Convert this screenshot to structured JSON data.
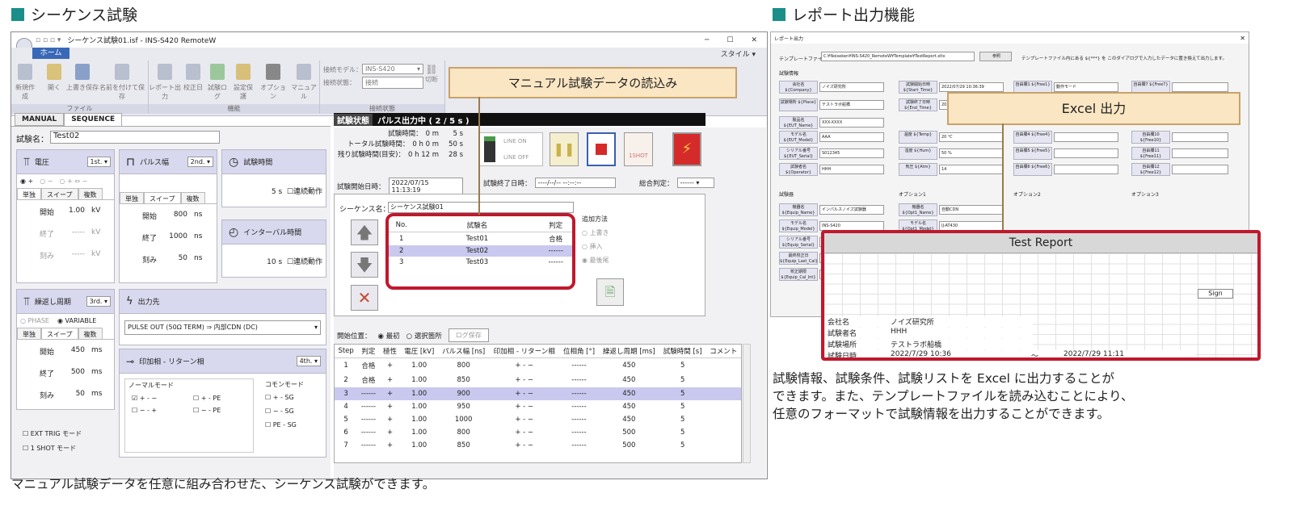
{
  "left_section": {
    "title": "シーケンス試験",
    "caption": "マニュアル試験データを任意に組み合わせた、シーケンス試験ができます。"
  },
  "right_section": {
    "title": "レポート出力機能",
    "caption_lines": [
      "試験情報、試験条件、試験リストを Excel に出力することが",
      "できます。また、テンプレートファイルを読み込むことにより、",
      "任意のフォーマットで試験情報を出力することができます。"
    ]
  },
  "callouts": {
    "manual": "マニュアル試験データの読込み",
    "excel": "Excel 出力"
  },
  "app": {
    "title": "シーケンス試験01.isf - INS-S420 RemoteW",
    "home_tab": "ホーム",
    "style_label": "スタイル",
    "file_group": {
      "label": "ファイル",
      "buttons": [
        "新規作成",
        "開く",
        "上書き保存",
        "名前を付けて保存"
      ]
    },
    "func_group": {
      "label": "機能",
      "buttons": [
        "レポート出力",
        "校正日",
        "試験ログ",
        "設定保護",
        "オプション",
        "マニュアル"
      ]
    },
    "conn_group": {
      "label": "接続状態",
      "model_label": "接続モデル：",
      "model_value": "INS-S420",
      "state_label": "接続状態：",
      "state_value": "接続",
      "disconnect": "切断"
    },
    "mode_tabs": [
      "MANUAL",
      "SEQUENCE"
    ],
    "test_name_label": "試験名：",
    "test_name_value": "Test02",
    "voltage": {
      "title": "電圧",
      "order": "1st.",
      "polarity": [
        "+",
        "−",
        "+ ⇔ −"
      ],
      "tabs": [
        "単独",
        "スイープ",
        "複数"
      ],
      "rows": [
        [
          "開始",
          "1.00",
          "kV"
        ],
        [
          "終了",
          "-----",
          "kV"
        ],
        [
          "刻み",
          "-----",
          "kV"
        ]
      ]
    },
    "pulse_width": {
      "title": "パルス幅",
      "order": "2nd.",
      "tabs": [
        "単独",
        "スイープ",
        "複数"
      ],
      "rows": [
        [
          "開始",
          "800",
          "ns"
        ],
        [
          "終了",
          "1000",
          "ns"
        ],
        [
          "刻み",
          "50",
          "ns"
        ]
      ]
    },
    "test_time": {
      "title": "試験時間",
      "value": "5",
      "unit": "s",
      "check": "連続動作"
    },
    "interval": {
      "title": "インターバル時間",
      "value": "10",
      "unit": "s",
      "check": "連続動作"
    },
    "repeat": {
      "title": "繰返し周期",
      "order": "3rd.",
      "radios": [
        "PHASE",
        "VARIABLE"
      ],
      "tabs": [
        "単独",
        "スイープ",
        "複数"
      ],
      "rows": [
        [
          "開始",
          "450",
          "ms"
        ],
        [
          "終了",
          "500",
          "ms"
        ],
        [
          "刻み",
          "50",
          "ms"
        ]
      ]
    },
    "output": {
      "title": "出力先",
      "value": "PULSE OUT (50Ω TERM) ⇒ 内部CDN (DC)"
    },
    "phase": {
      "title": "印加相 - リターン相",
      "order": "4th.",
      "normal_label": "ノーマルモード",
      "normal_items": [
        "+ - −",
        "+ - PE",
        "− - +",
        "− - PE"
      ],
      "common_label": "コモンモード",
      "common_items": [
        "+ - SG",
        "− - SG",
        "PE - SG"
      ]
    },
    "ext_trig": "EXT TRIG モード",
    "one_shot": "1 SHOT モード",
    "status": {
      "label": "試験状態",
      "value": "パルス出力中 ( 2 / 5 s )"
    },
    "times": [
      [
        "試験時間：",
        "0 m",
        "5 s"
      ],
      [
        "トータル試験時間：",
        "0 h  0 m",
        "50 s"
      ],
      [
        "残り試験時間(目安)：",
        "0 h  12 m",
        "28 s"
      ]
    ],
    "line_on": "LINE ON",
    "line_off": "LINE OFF",
    "oneshot_btn": "1SHOT",
    "start_label": "試験開始日時：",
    "start_value": "2022/07/15 11:13:19",
    "end_label": "試験終了日時：",
    "end_value": "----/--/-- --:--:--",
    "judge_label": "総合判定：",
    "judge_value": "------",
    "seq_name_label": "シーケンス名：",
    "seq_name_value": "シーケンス試験01",
    "seq_table": {
      "headers": [
        "No.",
        "試験名",
        "判定"
      ],
      "rows": [
        [
          "1",
          "Test01",
          "合格"
        ],
        [
          "2",
          "Test02",
          "------"
        ],
        [
          "3",
          "Test03",
          "------"
        ]
      ]
    },
    "add_method": {
      "label": "追加方法",
      "options": [
        "上書き",
        "挿入",
        "最後尾"
      ]
    },
    "start_pos": {
      "label": "開始位置：",
      "options": [
        "最初",
        "選択箇所"
      ],
      "log_btn": "ログ保存"
    },
    "result_table": {
      "headers": [
        "Step",
        "判定",
        "極性",
        "電圧 [kV]",
        "パルス幅 [ns]",
        "印加相 - リターン相",
        "位相角 [°]",
        "繰返し周期 [ms]",
        "試験時間 [s]",
        "コメント"
      ],
      "rows": [
        [
          "1",
          "合格",
          "+",
          "1.00",
          "800",
          "+ - −",
          "------",
          "450",
          "5",
          ""
        ],
        [
          "2",
          "合格",
          "+",
          "1.00",
          "850",
          "+ - −",
          "------",
          "450",
          "5",
          ""
        ],
        [
          "3",
          "------",
          "+",
          "1.00",
          "900",
          "+ - −",
          "------",
          "450",
          "5",
          ""
        ],
        [
          "4",
          "------",
          "+",
          "1.00",
          "950",
          "+ - −",
          "------",
          "450",
          "5",
          ""
        ],
        [
          "5",
          "------",
          "+",
          "1.00",
          "1000",
          "+ - −",
          "------",
          "450",
          "5",
          ""
        ],
        [
          "6",
          "------",
          "+",
          "1.00",
          "800",
          "+ - −",
          "------",
          "500",
          "5",
          ""
        ],
        [
          "7",
          "------",
          "+",
          "1.00",
          "850",
          "+ - −",
          "------",
          "500",
          "5",
          ""
        ]
      ]
    }
  },
  "report_dialog": {
    "title": "レポート出力",
    "template_label": "テンプレートファイル",
    "template_path": "C:¥Noiseken¥INS-S420_RemoteW¥Template¥TestReport.xltx",
    "browse": "参照",
    "hint": "テンプレートファイル内にある ${***} を このダイアログで入力したデータに置き換えて出力します。",
    "section_info": "試験情報",
    "section_instr": "試験器",
    "opt_labels": [
      "オプション1",
      "オプション2",
      "オプション3"
    ],
    "fields": [
      [
        "会社名 ${Company}",
        "ノイズ研究所"
      ],
      [
        "試験場所 ${Place}",
        "テストラボ船橋"
      ],
      [
        "製品名 ${EUT_Name}",
        "XXX-XXXX"
      ],
      [
        "モデル名 ${EUT_Model}",
        "AAA"
      ],
      [
        "シリアル番号 ${EUT_Serial}",
        "S012345"
      ],
      [
        "試験者名 ${Operator}",
        "HHH"
      ],
      [
        "試験開始日時 ${Start_Time}",
        "2022/07/29 10:36:39"
      ],
      [
        "試験終了日時 ${End_Time}",
        "2022/07/29 11:11"
      ],
      [
        "温度 ${Temp}",
        "20 ℃"
      ],
      [
        "湿度 ${Hum}",
        "50 %"
      ],
      [
        "気圧 ${Atm}",
        "14"
      ],
      [
        "自由欄1 ${Free1}",
        "動作モード"
      ],
      [
        "自由欄4 ${Free4}",
        ""
      ],
      [
        "自由欄5 ${Free5}",
        ""
      ],
      [
        "自由欄6 ${Free6}",
        ""
      ],
      [
        "自由欄7 ${Free7}",
        ""
      ],
      [
        "自由欄10 ${Free10}",
        ""
      ],
      [
        "自由欄11 ${Free11}",
        ""
      ],
      [
        "自由欄12 ${Free12}",
        ""
      ],
      [
        "機器名 ${Equip_Name}",
        "インパルスノイズ試験器"
      ],
      [
        "モデル名 ${Equip_Model}",
        "INS-S420"
      ],
      [
        "シリアル番号 ${Equip_Serial}",
        ""
      ],
      [
        "最終校正日 ${Equip_Last_Cal}",
        ""
      ],
      [
        "校正期限 ${Equip_Cal_Int}",
        ""
      ],
      [
        "機器名 ${Opt1_Name}",
        "自動CDN"
      ],
      [
        "モデル名 ${Opt1_Model}",
        "IJ-AT430"
      ]
    ]
  },
  "report": {
    "title": "Test Report",
    "sign": "Sign",
    "rows": [
      [
        "会社名",
        "ノイズ研究所"
      ],
      [
        "試験者名",
        "HHH"
      ],
      [
        "試験場所",
        "テストラボ船橋"
      ],
      [
        "試験日時",
        "2022/7/29 10:36"
      ]
    ],
    "date_sep": "〜",
    "end_date": "2022/7/29 11:11"
  }
}
